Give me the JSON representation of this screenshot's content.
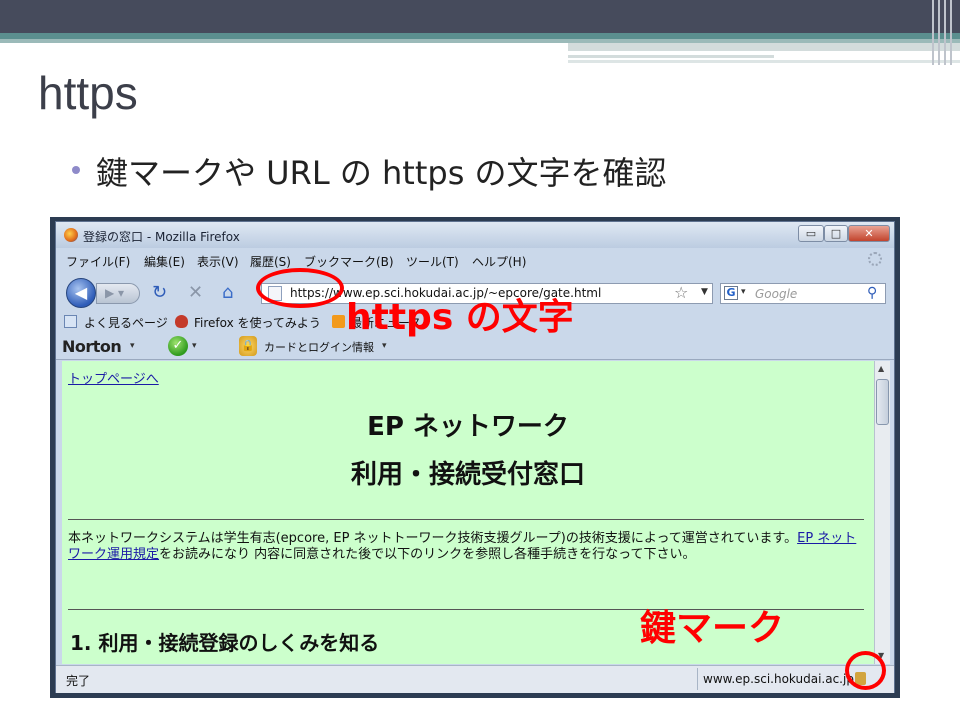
{
  "slide": {
    "title": "https",
    "bullet": "鍵マークや URL の https の文字を確認"
  },
  "window": {
    "title": "登録の窓口 - Mozilla Firefox",
    "controls": {
      "minimize": "▭",
      "maximize": "□",
      "close": "✕"
    }
  },
  "menu": [
    "ファイル(F)",
    "編集(E)",
    "表示(V)",
    "履歴(S)",
    "ブックマーク(B)",
    "ツール(T)",
    "ヘルプ(H)"
  ],
  "nav": {
    "url": "https://www.ep.sci.hokudai.ac.jp/~epcore/gate.html",
    "search_placeholder": "Google"
  },
  "bookmarks": [
    "よく見るページ",
    "Firefox を使ってみよう",
    "最新ニュース"
  ],
  "norton": {
    "brand": "Norton",
    "card_label": "カードとログイン情報"
  },
  "page": {
    "top_link": "トップページへ",
    "heading1": "EP ネットワーク",
    "heading2": "利用・接続受付窓口",
    "para_before": "本ネットワークシステムは学生有志(epcore, EP ネットトーワーク技術支援グループ)の技術支援によって運営されています。",
    "para_link": "EP ネットワーク運用規定",
    "para_after": "をお読みになり 内容に同意された後で以下のリンクを参照し各種手続きを行なって下さい。",
    "section_heading": "1. 利用・接続登録のしくみを知る"
  },
  "status": {
    "text": "完了",
    "url": "www.ep.sci.hokudai.ac.jp"
  },
  "annotations": {
    "https_label": "https の文字",
    "lock_label": "鍵マーク"
  },
  "colors": {
    "annotation": "#ff0000",
    "page_background": "#ccffcc",
    "bullet": "#8e8ac9"
  }
}
